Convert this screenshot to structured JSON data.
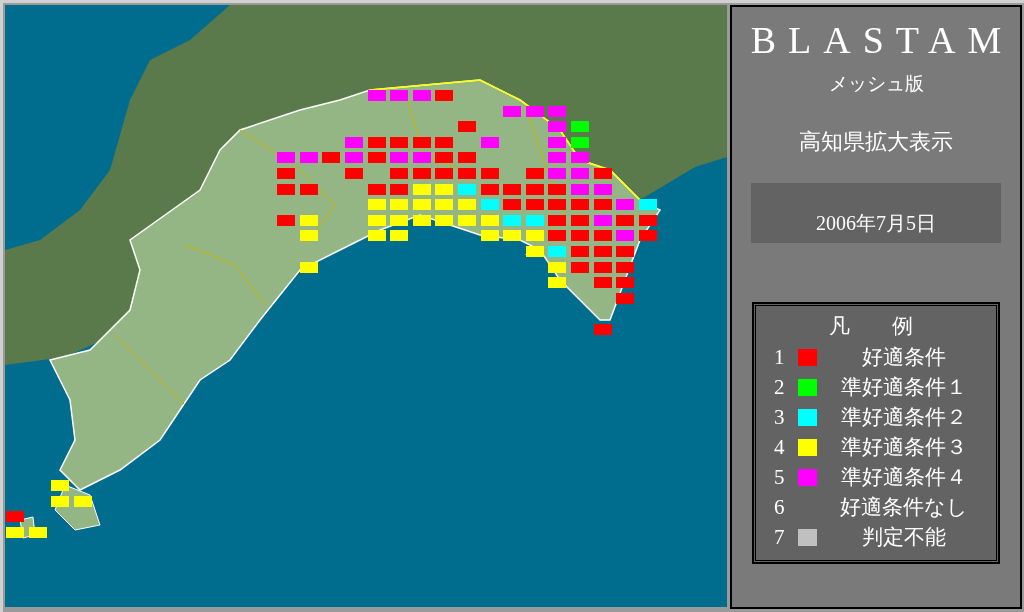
{
  "panel": {
    "title": "BLASTAM",
    "subtitle": "メッシュ版",
    "view": "高知県拡大表示",
    "date": "2006年7月5日"
  },
  "legend": {
    "title": "凡　　例",
    "items": [
      {
        "number": "1",
        "color": "#ff0000",
        "label": "好適条件"
      },
      {
        "number": "2",
        "color": "#00ff00",
        "label": "準好適条件１"
      },
      {
        "number": "3",
        "color": "#00ffff",
        "label": "準好適条件２"
      },
      {
        "number": "4",
        "color": "#ffff00",
        "label": "準好適条件３"
      },
      {
        "number": "5",
        "color": "#ff00ff",
        "label": "準好適条件４"
      },
      {
        "number": "6",
        "label": "好適条件なし"
      },
      {
        "number": "7",
        "color": "#c0c0c0",
        "label": "判定不能"
      }
    ]
  }
}
